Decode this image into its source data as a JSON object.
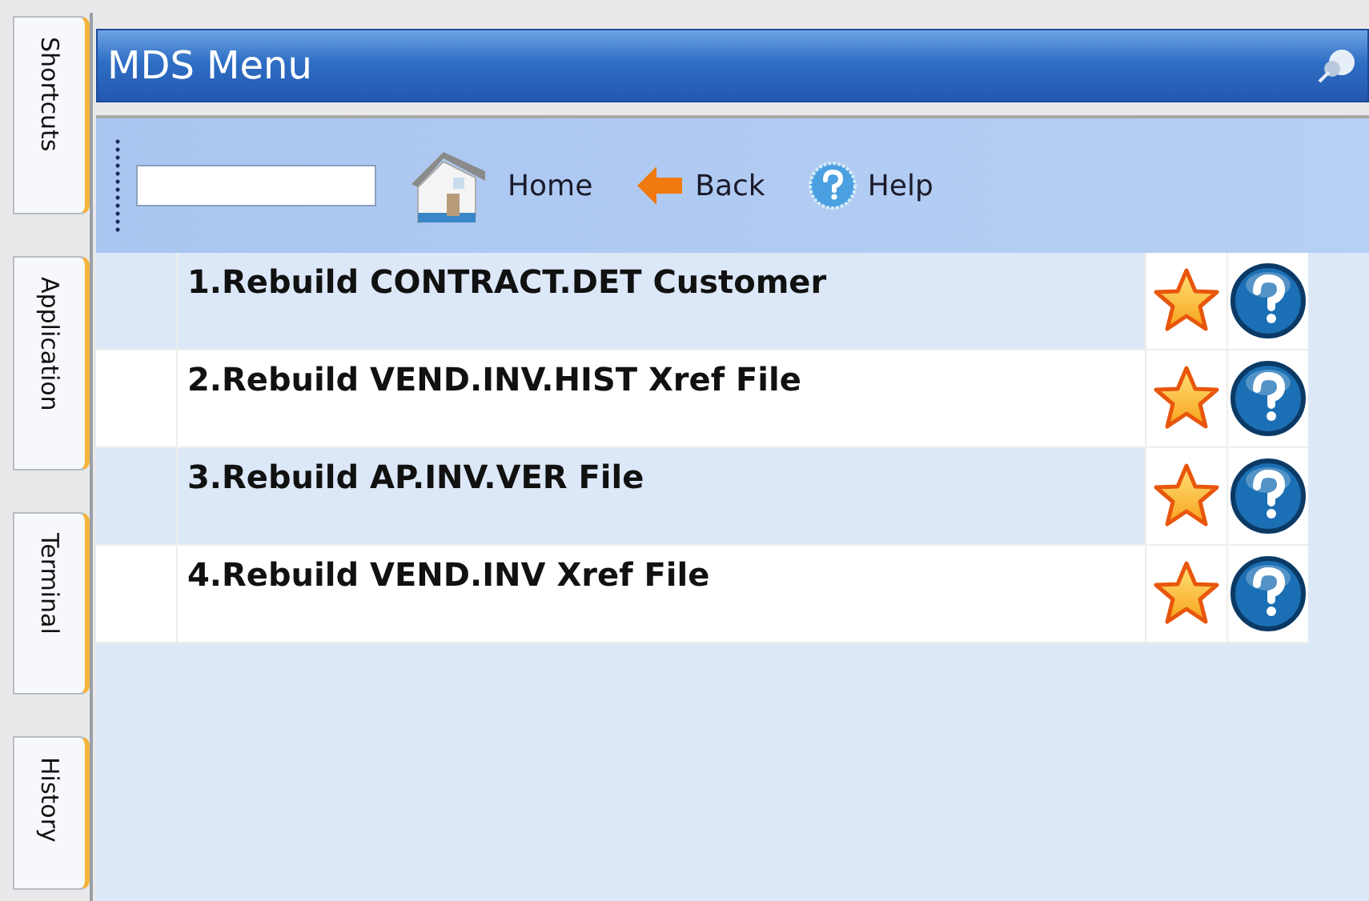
{
  "side_tabs": [
    {
      "label": "Shortcuts"
    },
    {
      "label": "Application"
    },
    {
      "label": "Terminal"
    },
    {
      "label": "History"
    }
  ],
  "window": {
    "title": "MDS Menu"
  },
  "toolbar": {
    "buttons": [
      {
        "label": "Home",
        "kind": "home"
      },
      {
        "label": "Back",
        "kind": "back"
      },
      {
        "label": "Help",
        "kind": "help"
      }
    ]
  },
  "menu_items": [
    {
      "label": "1.Rebuild CONTRACT.DET Customer"
    },
    {
      "label": "2.Rebuild VEND.INV.HIST Xref File"
    },
    {
      "label": "3.Rebuild AP.INV.VER File"
    },
    {
      "label": "4.Rebuild VEND.INV Xref File"
    }
  ]
}
